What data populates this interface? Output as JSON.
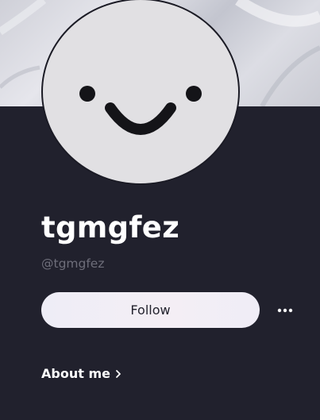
{
  "profile": {
    "display_name": "tgmgfez",
    "handle": "@tgmgfez"
  },
  "actions": {
    "follow_label": "Follow",
    "more_icon": "more-horizontal-icon"
  },
  "about": {
    "label": "About me",
    "icon": "chevron-right-icon"
  },
  "colors": {
    "background": "#21212d",
    "avatar_fill": "#e1e0e3",
    "follow_button": "#eeedf6",
    "handle_text": "#6e6e7a"
  }
}
